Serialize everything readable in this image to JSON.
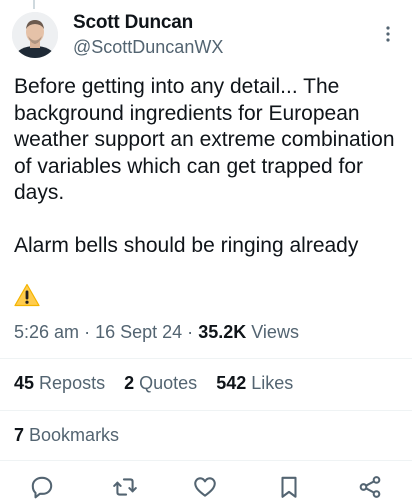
{
  "tweet": {
    "author_name": "Scott Duncan",
    "author_handle": "@ScottDuncanWX",
    "text": "Before getting into any detail... The background ingredients for European weather support an extreme combination of variables which can get trapped for days.\n\nAlarm bells should be ringing already",
    "emoji_icon": "warning-icon"
  },
  "meta": {
    "time": "5:26 am",
    "separator": "·",
    "date": "16 Sept 24",
    "views_count": "35.2K",
    "views_label": "Views"
  },
  "stats": {
    "reposts_count": "45",
    "reposts_label": "Reposts",
    "quotes_count": "2",
    "quotes_label": "Quotes",
    "likes_count": "542",
    "likes_label": "Likes",
    "bookmarks_count": "7",
    "bookmarks_label": "Bookmarks"
  },
  "actions": [
    "reply-icon",
    "repost-icon",
    "like-icon",
    "bookmark-icon",
    "share-icon"
  ],
  "colors": {
    "text": "#0f1419",
    "secondary": "#536471",
    "divider": "#eff3f4",
    "warning": "#ffcc4d"
  }
}
